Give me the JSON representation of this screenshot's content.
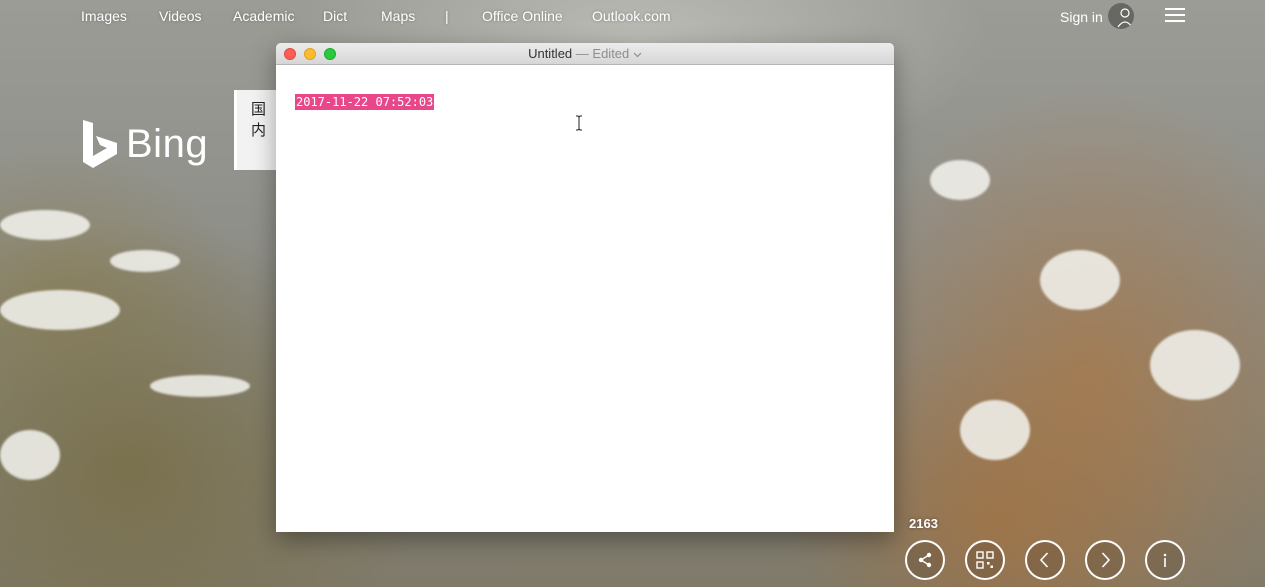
{
  "topnav": {
    "items": [
      "Images",
      "Videos",
      "Academic",
      "Dict",
      "Maps",
      "|",
      "Office Online",
      "Outlook.com"
    ],
    "signin_label": "Sign in"
  },
  "brand": {
    "logo_text": "Bing",
    "search_tab_text": "国内"
  },
  "editor": {
    "title": "Untitled",
    "separator": "—",
    "status": "Edited",
    "content": "2017-11-22 07:52:03",
    "selection_color": "#e8488a"
  },
  "gallery": {
    "count": "2163",
    "controls": [
      "share-icon",
      "qr-code-icon",
      "previous-icon",
      "next-icon",
      "info-icon"
    ]
  }
}
